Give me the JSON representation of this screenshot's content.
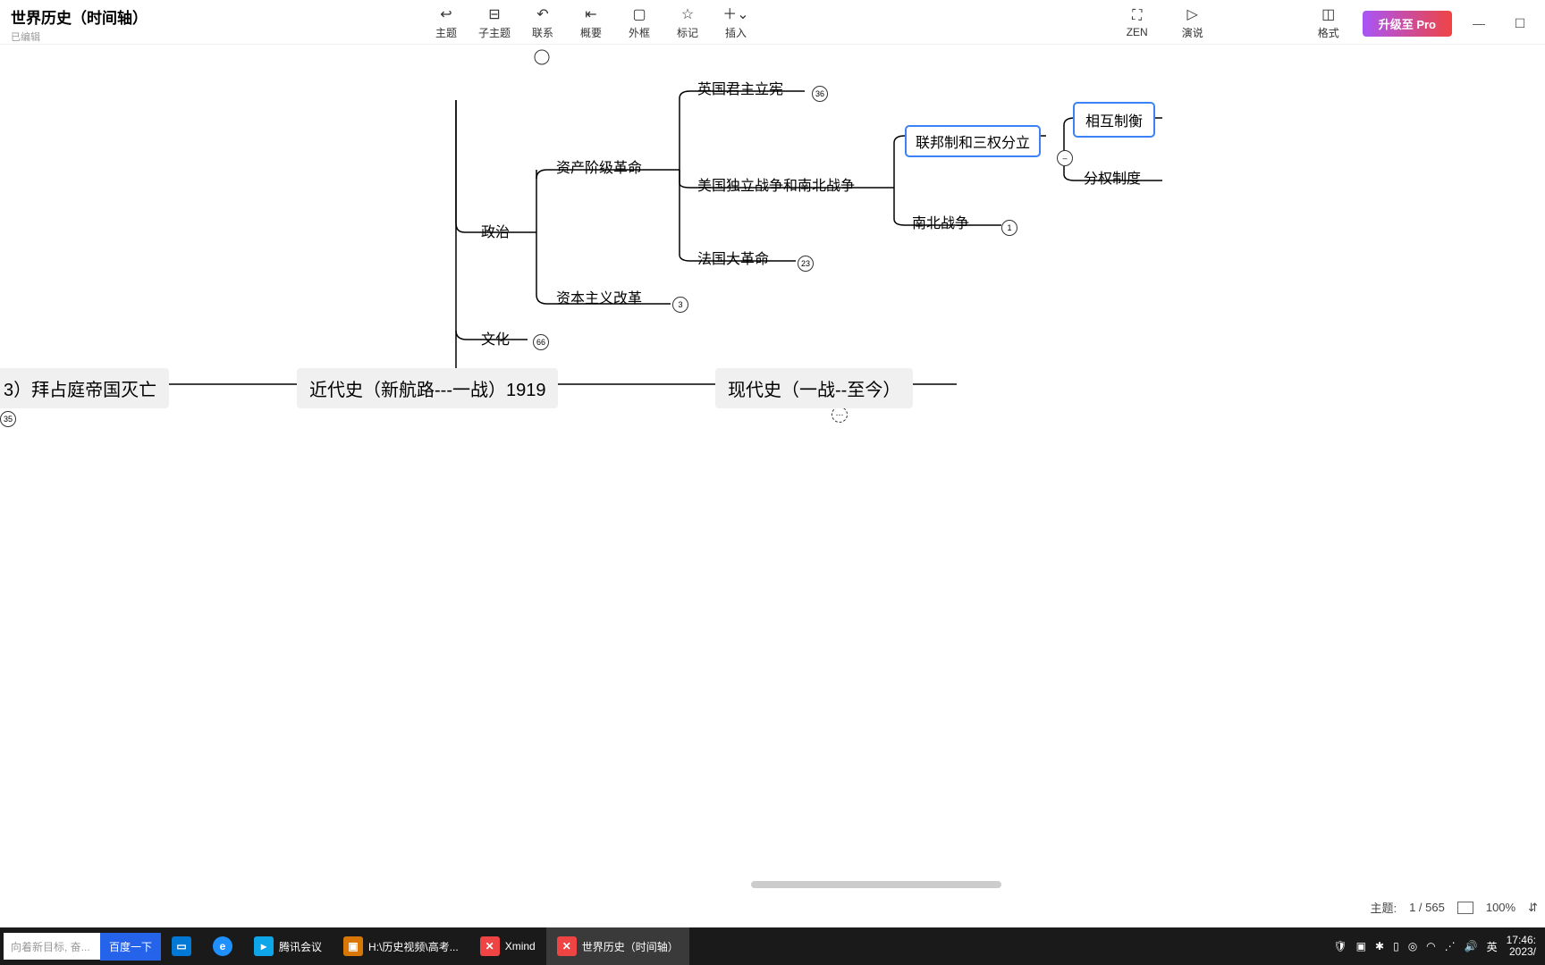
{
  "doc": {
    "title": "世界历史（时间轴）",
    "status": "已编辑"
  },
  "toolbar": [
    {
      "icon": "↩",
      "label": "主题"
    },
    {
      "icon": "⊟",
      "label": "子主题"
    },
    {
      "icon": "↶",
      "label": "联系"
    },
    {
      "icon": "⇤",
      "label": "概要"
    },
    {
      "icon": "▢",
      "label": "外框"
    },
    {
      "icon": "☆",
      "label": "标记"
    },
    {
      "icon": "＋⌄",
      "label": "插入"
    }
  ],
  "toolbar_right": [
    {
      "icon": "⛶",
      "label": "ZEN"
    },
    {
      "icon": "▷",
      "label": "演说"
    },
    {
      "icon": "◫",
      "label": "格式"
    }
  ],
  "pro": "升级至 Pro",
  "nodes": {
    "politics": "政治",
    "culture": "文化",
    "bourgeois_rev": "资产阶级革命",
    "capitalist_reform": "资本主义改革",
    "uk_monarchy": "英国君主立宪",
    "us_war": "美国独立战争和南北战争",
    "french_rev": "法国大革命",
    "federal_sep": "联邦制和三权分立",
    "civil_war": "南北战争",
    "checks_balance": "相互制衡",
    "sep_power": "分权制度"
  },
  "counts": {
    "uk": "36",
    "french": "23",
    "reform": "3",
    "culture": "66",
    "civil": "1",
    "left35": "35"
  },
  "timeline": {
    "n1": "3）拜占庭帝国灭亡",
    "n2": "近代史（新航路---一战）1919",
    "n3": "现代史（一战--至今）"
  },
  "status": {
    "topics_label": "主题:",
    "topics": "1 / 565",
    "zoom": "100%"
  },
  "taskbar": {
    "search_placeholder": "向着新目标, 奋...",
    "baidu": "百度一下",
    "items": [
      {
        "name": "explorer",
        "bg": "#0078d4",
        "txt": "▢",
        "label": ""
      },
      {
        "name": "edge",
        "bg": "#0078d4",
        "txt": "e",
        "label": ""
      },
      {
        "name": "tencent",
        "bg": "#0ea5e9",
        "txt": "▶",
        "label": "腾讯会议"
      },
      {
        "name": "folder",
        "bg": "#d97706",
        "txt": "📁",
        "label": "H:\\历史视频\\高考..."
      },
      {
        "name": "xmind1",
        "bg": "#ef4444",
        "txt": "✕",
        "label": "Xmind"
      },
      {
        "name": "xmind2",
        "bg": "#ef4444",
        "txt": "✕",
        "label": "世界历史（时间轴）"
      }
    ],
    "tray_icons": [
      "🛡",
      "⬒",
      "✱",
      "▯",
      "⬒",
      "◍",
      "◠",
      "🔊"
    ],
    "lang": "英",
    "time": "17:46:",
    "date": "2023/"
  }
}
